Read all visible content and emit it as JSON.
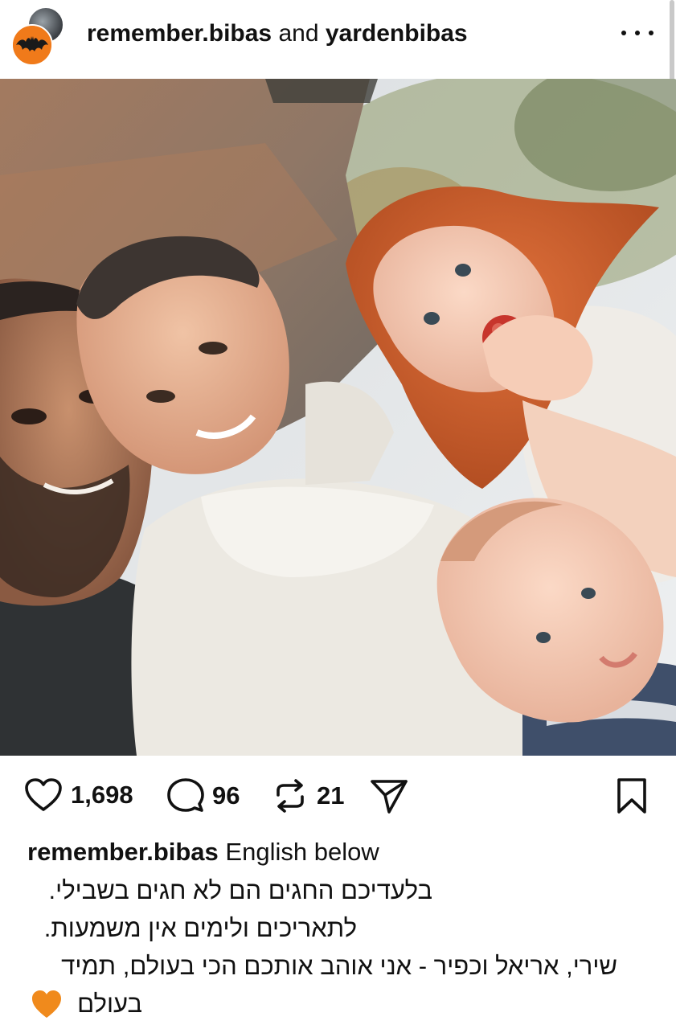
{
  "header": {
    "user1": "remember.bibas",
    "conjunction": "and",
    "user2": "yardenbibas",
    "more_icon": "more-horizontal-icon"
  },
  "photo": {
    "icon": "post-photo"
  },
  "actions": {
    "likes": "1,698",
    "comments": "96",
    "reposts": "21",
    "icons": [
      "heart-icon",
      "comment-icon",
      "repost-icon",
      "share-icon",
      "bookmark-icon"
    ]
  },
  "caption": {
    "username": "remember.bibas",
    "intro": "English below",
    "lines": [
      "בלעדיכם החגים הם לא חגים בשבילי.",
      "לתאריכים ולימים אין משמעות.",
      "שירי, אריאל וכפיר - אני אוהב אותכם הכי בעולם, תמיד",
      "בעולם"
    ],
    "emoji": "orange-heart-icon",
    "emoji_color": "#f08a1c"
  },
  "colors": {
    "avatar_bg": "#f07a1a",
    "text": "#111111"
  }
}
